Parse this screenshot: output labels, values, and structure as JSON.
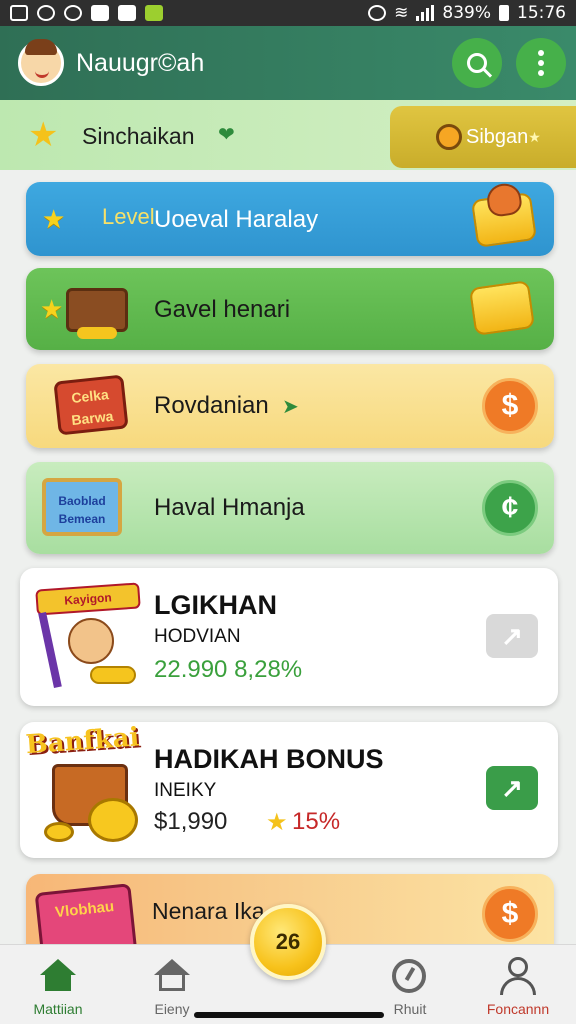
{
  "status_bar": {
    "battery_text": "839%",
    "time": "15:76"
  },
  "app_bar": {
    "title": "Nauugr©ah"
  },
  "sub_bar": {
    "label": "Sinchaikan",
    "button_label": "Sibgan"
  },
  "cards": [
    {
      "tag": "Level",
      "label": "Uoeval Haralay"
    },
    {
      "label": "Gavel henari"
    },
    {
      "label": "Rovdanian",
      "art_text": "Celka Barwa",
      "button_symbol": "$"
    },
    {
      "label": "Haval Hmanja",
      "art_text": "Baoblad Bemean",
      "button_symbol": "¢"
    }
  ],
  "promos": [
    {
      "title": "LGIKHAN",
      "subtitle": "HODVIAN",
      "stat": "22.990 8,28%",
      "art_text": "Kayigon",
      "stat_color": "#3aa03c"
    },
    {
      "title": "HADIKAH BONUS",
      "subtitle": "INEIKY",
      "stat_value": "$1,990",
      "stat_percent": "15%",
      "art_text": "Banfkai",
      "stat_color": "#c62828"
    }
  ],
  "promo3": {
    "label": "Nenara Ika",
    "art_text": "Vlobhau",
    "button_symbol": "$"
  },
  "fab_label": "26",
  "nav": [
    {
      "label": "Mattiian"
    },
    {
      "label": "Eieny"
    },
    {
      "label": "Rhuit"
    },
    {
      "label": "Foncannn"
    }
  ]
}
